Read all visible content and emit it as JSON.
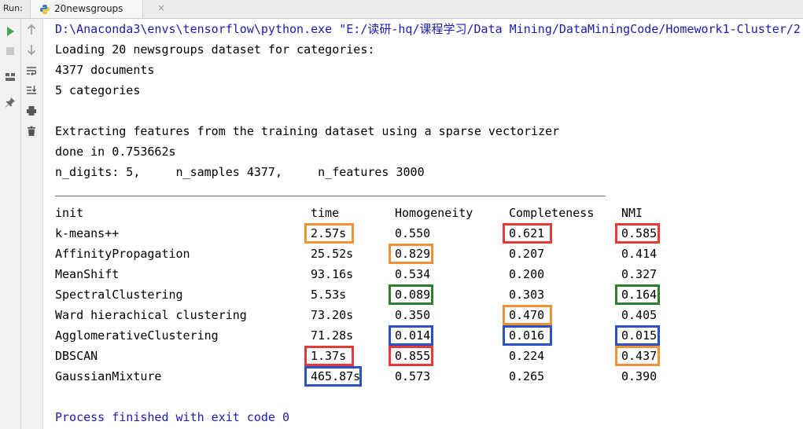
{
  "tabbar": {
    "run_label": "Run:",
    "tab_title": "20newsgroups",
    "tab_close": "×"
  },
  "console": {
    "command": "D:\\Anaconda3\\envs\\tensorflow\\python.exe \"E:/读研-hq/课程学习/Data Mining/DataMiningCode/Homework1-Cluster/2",
    "loading": "Loading 20 newsgroups dataset for categories:",
    "documents": "4377 documents",
    "categories": "5 categories",
    "extracting": "Extracting features from the training dataset using a sparse vectorizer",
    "done": "done in 0.753662s",
    "params": "n_digits: 5,     n_samples 4377,     n_features 3000",
    "separator": "_________________________________________________________________________________",
    "exit": "Process finished with exit code 0"
  },
  "table": {
    "headers": [
      "init",
      "time",
      "Homogeneity",
      "Completeness",
      "NMI"
    ],
    "rows": [
      [
        "k-means++",
        "2.57s",
        "0.550",
        "0.621",
        "0.585"
      ],
      [
        "AffinityPropagation",
        "25.52s",
        "0.829",
        "0.207",
        "0.414"
      ],
      [
        "MeanShift",
        "93.16s",
        "0.534",
        "0.200",
        "0.327"
      ],
      [
        "SpectralClustering",
        "5.53s",
        "0.089",
        "0.303",
        "0.164"
      ],
      [
        "Ward hierachical clustering",
        "73.20s",
        "0.350",
        "0.470",
        "0.405"
      ],
      [
        "AgglomerativeClustering",
        "71.28s",
        "0.014",
        "0.016",
        "0.015"
      ],
      [
        "DBSCAN",
        "1.37s",
        "0.855",
        "0.224",
        "0.437"
      ],
      [
        "GaussianMixture",
        "465.87s",
        "0.573",
        "0.265",
        "0.390"
      ]
    ]
  },
  "highlight_colors": {
    "red": "#e53935",
    "orange": "#f0913a",
    "green": "#2e7d32",
    "blue": "#2b50c8"
  },
  "highlights": [
    {
      "row": 0,
      "col": 1,
      "color": "orange"
    },
    {
      "row": 0,
      "col": 3,
      "color": "red"
    },
    {
      "row": 0,
      "col": 4,
      "color": "red"
    },
    {
      "row": 1,
      "col": 2,
      "color": "orange"
    },
    {
      "row": 3,
      "col": 2,
      "color": "green"
    },
    {
      "row": 3,
      "col": 4,
      "color": "green"
    },
    {
      "row": 4,
      "col": 3,
      "color": "orange"
    },
    {
      "row": 5,
      "col": 2,
      "color": "blue"
    },
    {
      "row": 5,
      "col": 3,
      "color": "blue"
    },
    {
      "row": 5,
      "col": 4,
      "color": "blue"
    },
    {
      "row": 6,
      "col": 1,
      "color": "red"
    },
    {
      "row": 6,
      "col": 2,
      "color": "red"
    },
    {
      "row": 6,
      "col": 4,
      "color": "orange"
    },
    {
      "row": 7,
      "col": 1,
      "color": "blue"
    }
  ],
  "icons": {
    "toolbar1": [
      "run-icon",
      "stop-icon",
      "layout-icon",
      "pin-icon"
    ],
    "toolbar2": [
      "up-arrow-icon",
      "down-arrow-icon",
      "soft-wrap-icon",
      "scroll-to-end-icon",
      "print-icon",
      "trash-icon"
    ]
  }
}
